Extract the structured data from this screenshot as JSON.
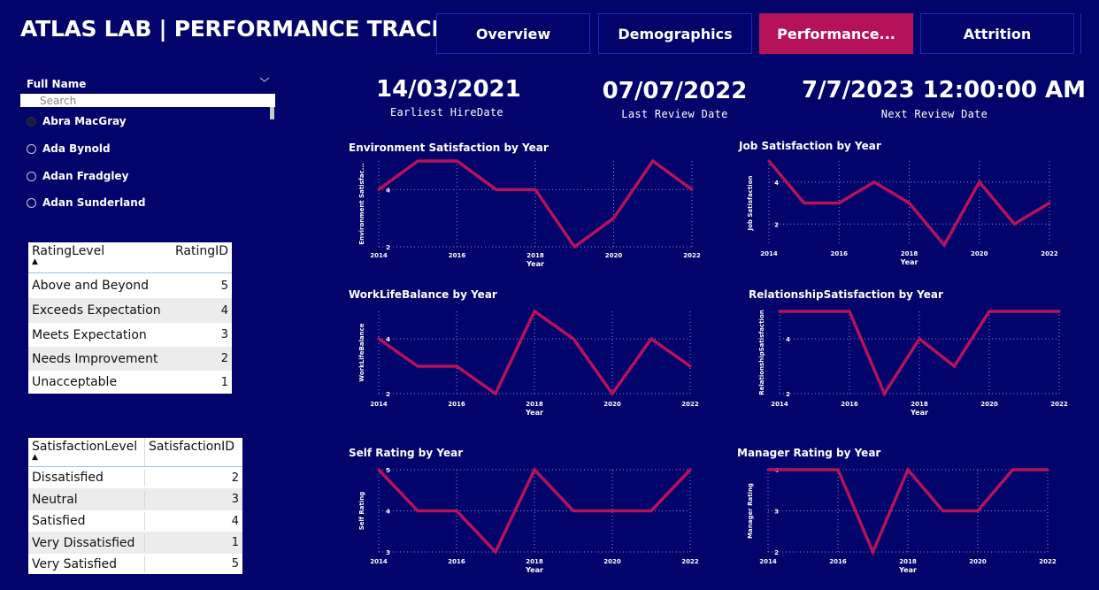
{
  "header": {
    "title": "ATLAS LAB | PERFORMANCE TRACKER",
    "nav": [
      "Overview",
      "Demographics",
      "Performance...",
      "Attrition"
    ],
    "active_index": 2
  },
  "slicer": {
    "label": "Full Name",
    "search_placeholder": "Search",
    "items": [
      "Abra MacGray",
      "Ada Bynold",
      "Adan Fradgley",
      "Adan Sunderland"
    ]
  },
  "rating_table": {
    "headers": [
      "RatingLevel",
      "RatingID"
    ],
    "rows": [
      [
        "Above and Beyond",
        "5"
      ],
      [
        "Exceeds Expectation",
        "4"
      ],
      [
        "Meets Expectation",
        "3"
      ],
      [
        "Needs Improvement",
        "2"
      ],
      [
        "Unacceptable",
        "1"
      ]
    ]
  },
  "satisfaction_table": {
    "headers": [
      "SatisfactionLevel",
      "SatisfactionID"
    ],
    "rows": [
      [
        "Dissatisfied",
        "2"
      ],
      [
        "Neutral",
        "3"
      ],
      [
        "Satisfied",
        "4"
      ],
      [
        "Very Dissatisfied",
        "1"
      ],
      [
        "Very Satisfied",
        "5"
      ]
    ]
  },
  "kpis": [
    {
      "value": "14/03/2021",
      "label": "Earliest HireDate"
    },
    {
      "value": "07/07/2022",
      "label": "Last Review Date"
    },
    {
      "value": "7/7/2023 12:00:00 AM",
      "label": "Next Review Date"
    }
  ],
  "colors": {
    "background": "#02036b",
    "line": "#b6125a",
    "active_tab": "#b6125a"
  },
  "chart_data": [
    {
      "type": "line",
      "title": "Environment Satisfaction by Year",
      "xlabel": "Year",
      "ylabel": "Environment Satisfac...",
      "x": [
        2014,
        2015,
        2016,
        2017,
        2018,
        2019,
        2020,
        2021,
        2022
      ],
      "values": [
        4,
        5,
        5,
        4,
        4,
        2,
        3,
        5,
        4
      ],
      "yticks": [
        2,
        4
      ],
      "xticks": [
        2014,
        2016,
        2018,
        2020,
        2022
      ],
      "ylim": [
        2,
        5
      ]
    },
    {
      "type": "line",
      "title": "Job Satisfaction by Year",
      "xlabel": "Year",
      "ylabel": "Job Satisfaction",
      "x": [
        2014,
        2015,
        2016,
        2017,
        2018,
        2019,
        2020,
        2021,
        2022
      ],
      "values": [
        5,
        3,
        3,
        4,
        3,
        1,
        4,
        2,
        3
      ],
      "yticks": [
        2,
        4
      ],
      "xticks": [
        2014,
        2016,
        2018,
        2020,
        2022
      ],
      "ylim": [
        1,
        5
      ]
    },
    {
      "type": "line",
      "title": "WorkLifeBalance by Year",
      "xlabel": "Year",
      "ylabel": "WorkLifeBalance",
      "x": [
        2014,
        2015,
        2016,
        2017,
        2018,
        2019,
        2020,
        2021,
        2022
      ],
      "values": [
        4,
        3,
        3,
        2,
        5,
        4,
        2,
        4,
        3
      ],
      "yticks": [
        2,
        4
      ],
      "xticks": [
        2014,
        2016,
        2018,
        2020,
        2022
      ],
      "ylim": [
        2,
        5
      ]
    },
    {
      "type": "line",
      "title": "RelationshipSatisfaction by Year",
      "xlabel": "Year",
      "ylabel": "RelationshipSatisfaction",
      "x": [
        2014,
        2015,
        2016,
        2017,
        2018,
        2019,
        2020,
        2021,
        2022
      ],
      "values": [
        5,
        5,
        5,
        2,
        4,
        3,
        5,
        5,
        5
      ],
      "yticks": [
        2,
        4
      ],
      "xticks": [
        2014,
        2016,
        2018,
        2020,
        2022
      ],
      "ylim": [
        2,
        5
      ]
    },
    {
      "type": "line",
      "title": "Self Rating by Year",
      "xlabel": "Year",
      "ylabel": "Self Rating",
      "x": [
        2014,
        2015,
        2016,
        2017,
        2018,
        2019,
        2020,
        2021,
        2022
      ],
      "values": [
        5,
        4,
        4,
        3,
        5,
        4,
        4,
        4,
        5
      ],
      "yticks": [
        3,
        4,
        5
      ],
      "xticks": [
        2014,
        2016,
        2018,
        2020,
        2022
      ],
      "ylim": [
        3,
        5
      ]
    },
    {
      "type": "line",
      "title": "Manager Rating by Year",
      "xlabel": "Year",
      "ylabel": "Manager Rating",
      "x": [
        2014,
        2015,
        2016,
        2017,
        2018,
        2019,
        2020,
        2021,
        2022
      ],
      "values": [
        4,
        4,
        4,
        2,
        4,
        3,
        3,
        4,
        4
      ],
      "yticks": [
        2,
        3,
        4
      ],
      "xticks": [
        2014,
        2016,
        2018,
        2020,
        2022
      ],
      "ylim": [
        2,
        4
      ]
    }
  ]
}
